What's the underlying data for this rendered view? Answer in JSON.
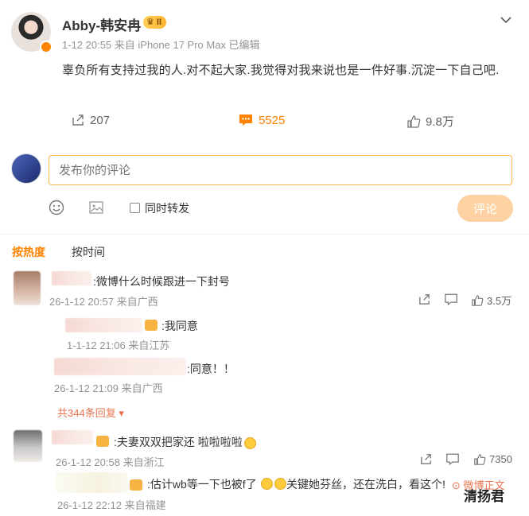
{
  "post": {
    "username": "Abby-韩安冉",
    "vip_badge": "II",
    "meta": "1-12 20:55 来自 iPhone 17 Pro Max 已编辑",
    "text": "辜负所有支持过我的人.对不起大家.我觉得对我来说也是一件好事.沉淀一下自己吧.",
    "repost_count": "207",
    "comment_count": "5525",
    "like_count": "9.8万"
  },
  "composer": {
    "placeholder": "发布你的评论",
    "repost_label": "同时转发",
    "submit_label": "评论"
  },
  "sort": {
    "hot": "按热度",
    "time": "按时间"
  },
  "comments": [
    {
      "text": ":微博什么时候跟进一下封号",
      "time": "26-1-12 20:57 来自广西",
      "likes": "3.5万",
      "replies": [
        {
          "text": ":我同意",
          "time": "1-1-12 21:06 来自江苏"
        },
        {
          "text": ":同意！！",
          "time": "26-1-12 21:09 来自广西"
        }
      ],
      "expand": "共344条回复"
    },
    {
      "text_pre": ":夫妻双双把家还 ",
      "text_post": "啦啦啦啦",
      "time": "26-1-12 20:58 来自浙江",
      "likes": "7350",
      "replies": [
        {
          "text_a": ":估计wb等一下也被f了",
          "text_b": "关键她芬丝，还在洗白，看这个!",
          "link": "微博正文",
          "time": "26-1-12 22:12 来自福建"
        }
      ]
    }
  ],
  "watermark": "清扬君",
  "colors": {
    "accent": "#ff8200",
    "link": "#eb7350",
    "submit_disabled": "#ffd2a3"
  }
}
